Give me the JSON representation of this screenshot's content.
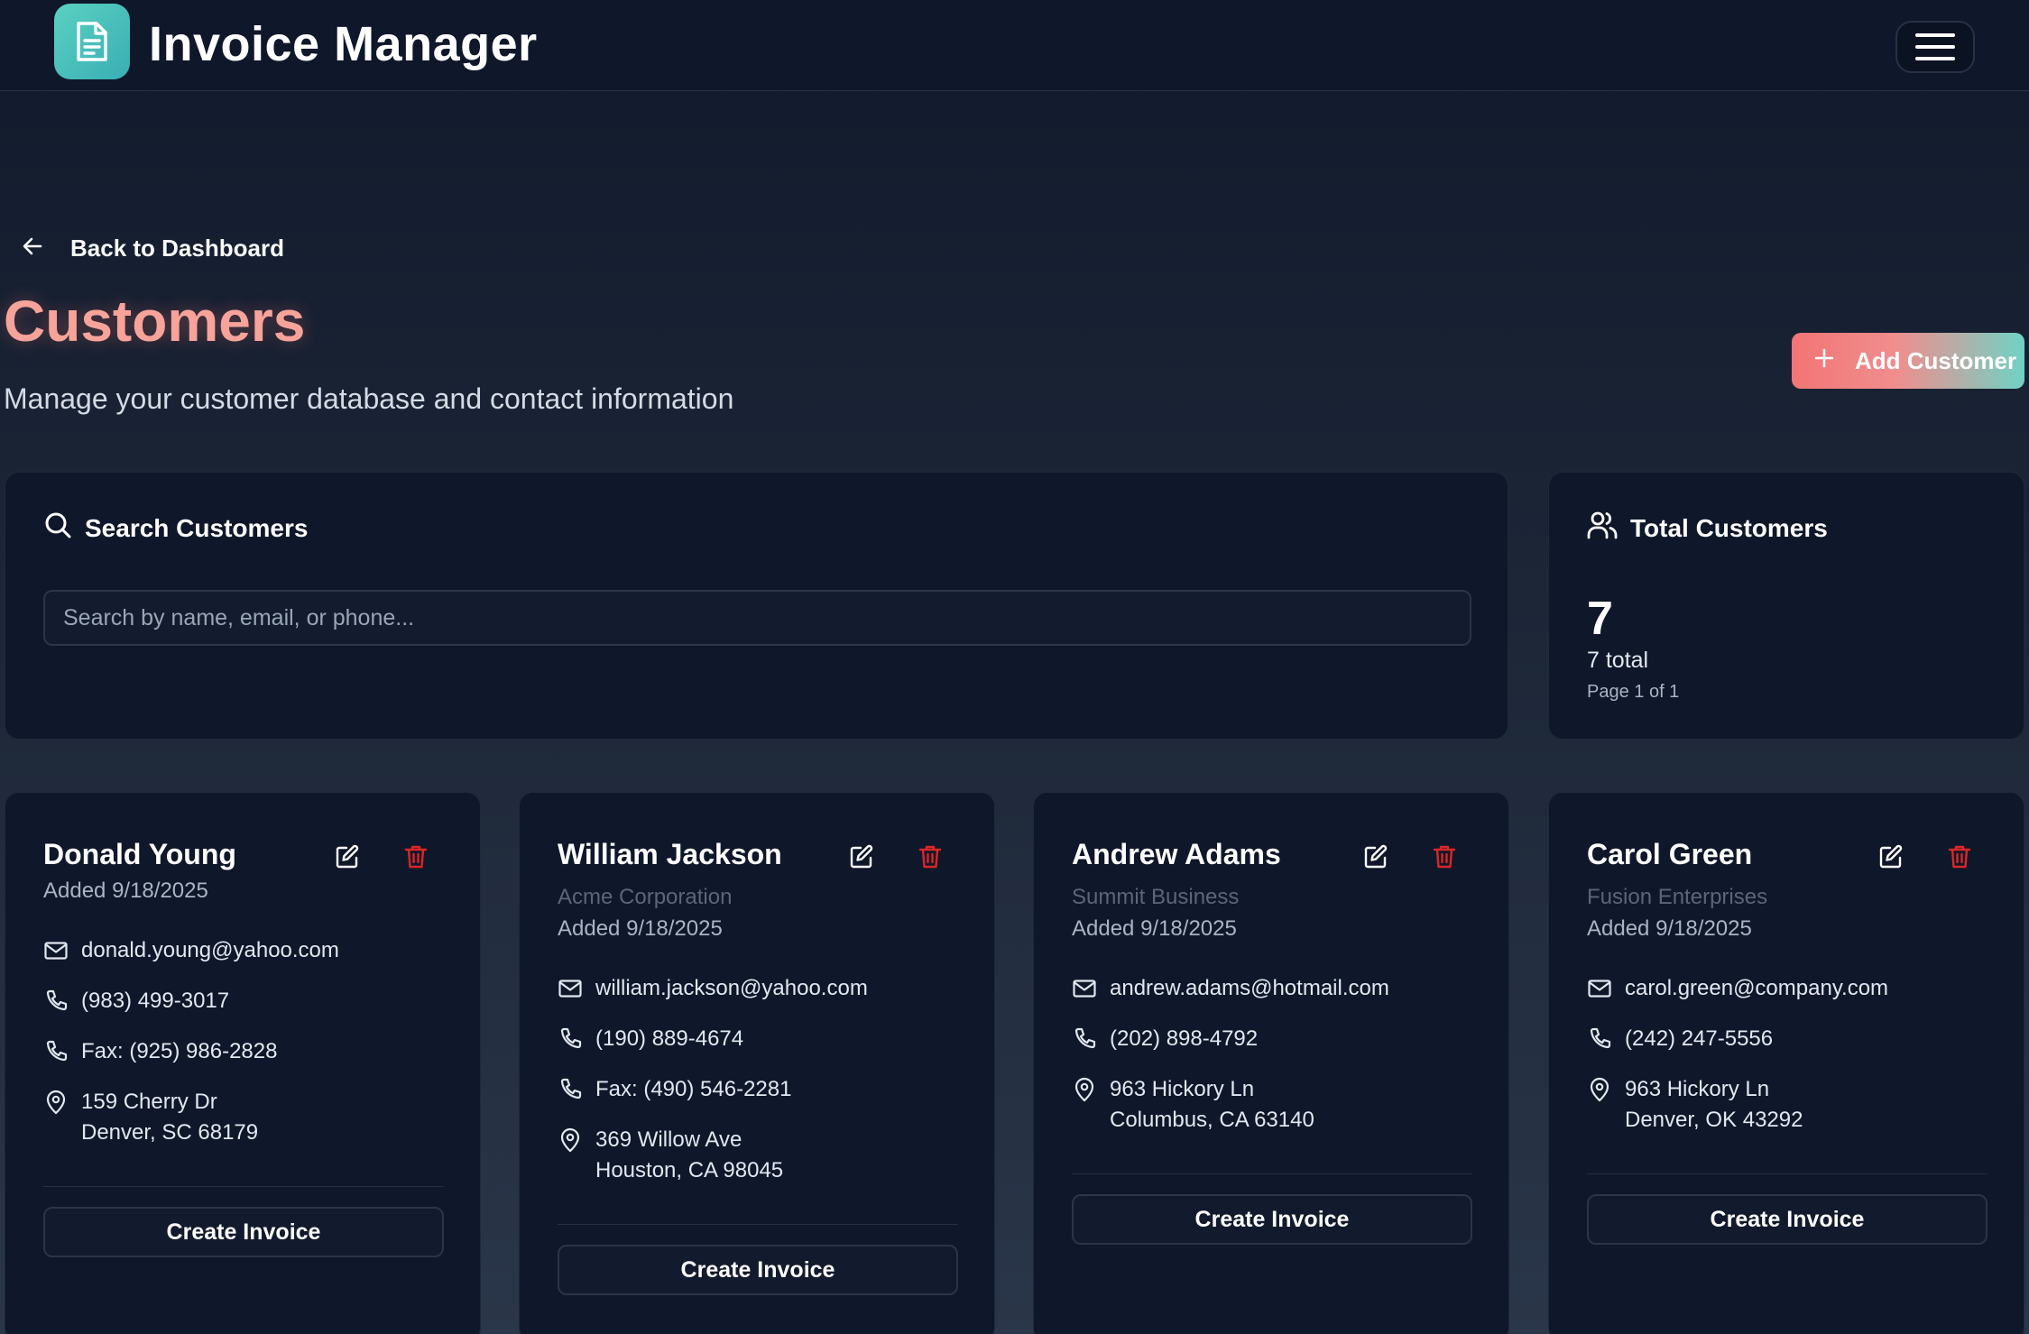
{
  "header": {
    "title": "Invoice Manager",
    "logo_icon": "document-icon",
    "menu_icon": "hamburger-menu-icon"
  },
  "nav": {
    "back_label": "Back to Dashboard"
  },
  "page": {
    "title": "Customers",
    "subtitle": "Manage your customer database and contact information",
    "add_button_label": "Add Customer"
  },
  "search": {
    "heading": "Search Customers",
    "placeholder": "Search by name, email, or phone...",
    "value": ""
  },
  "totals": {
    "heading": "Total Customers",
    "count": "7",
    "total_label": "7 total",
    "page_label": "Page 1 of 1"
  },
  "customers": [
    {
      "name": "Donald Young",
      "company": "",
      "added": "Added 9/18/2025",
      "email": "donald.young@yahoo.com",
      "phone": "(983) 499-3017",
      "fax": "Fax: (925) 986-2828",
      "address_line1": "159 Cherry Dr",
      "address_line2": "Denver, SC 68179",
      "button_label": "Create Invoice"
    },
    {
      "name": "William Jackson",
      "company": "Acme Corporation",
      "added": "Added 9/18/2025",
      "email": "william.jackson@yahoo.com",
      "phone": "(190) 889-4674",
      "fax": "Fax: (490) 546-2281",
      "address_line1": "369 Willow Ave",
      "address_line2": "Houston, CA 98045",
      "button_label": "Create Invoice"
    },
    {
      "name": "Andrew Adams",
      "company": "Summit Business",
      "added": "Added 9/18/2025",
      "email": "andrew.adams@hotmail.com",
      "phone": "(202) 898-4792",
      "fax": "",
      "address_line1": "963 Hickory Ln",
      "address_line2": "Columbus, CA 63140",
      "button_label": "Create Invoice"
    },
    {
      "name": "Carol Green",
      "company": "Fusion Enterprises",
      "added": "Added 9/18/2025",
      "email": "carol.green@company.com",
      "phone": "(242) 247-5556",
      "fax": "",
      "address_line1": "963 Hickory Ln",
      "address_line2": "Denver, OK 43292",
      "button_label": "Create Invoice"
    }
  ],
  "colors": {
    "title_accent": "#f7a39a",
    "delete_red": "#dc2626",
    "panel_bg": "#0f172a"
  }
}
